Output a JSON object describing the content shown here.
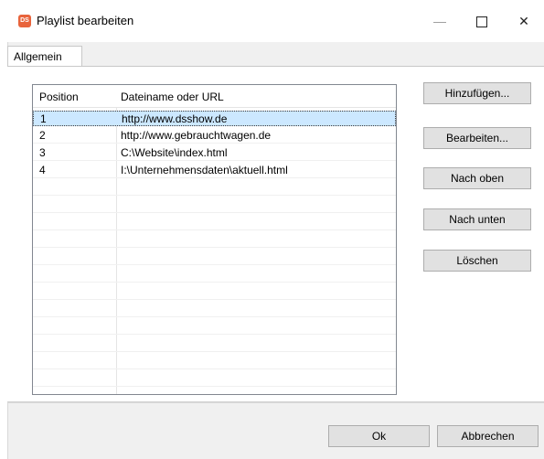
{
  "window": {
    "title": "Playlist bearbeiten",
    "app_icon_text": "DS",
    "minimize_glyph": "—",
    "close_glyph": "✕"
  },
  "tabs": [
    {
      "label": "Allgemein",
      "selected": true
    }
  ],
  "playlist": {
    "columns": [
      "Position",
      "Dateiname oder URL"
    ],
    "rows": [
      {
        "position": "1",
        "file": "http://www.dsshow.de",
        "selected": true
      },
      {
        "position": "2",
        "file": "http://www.gebrauchtwagen.de",
        "selected": false
      },
      {
        "position": "3",
        "file": "C:\\Website\\index.html",
        "selected": false
      },
      {
        "position": "4",
        "file": "I:\\Unternehmensdaten\\aktuell.html",
        "selected": false
      }
    ]
  },
  "side_buttons": {
    "add": "Hinzufügen...",
    "edit": "Bearbeiten...",
    "move_up": "Nach oben",
    "move_down": "Nach unten",
    "delete": "Löschen"
  },
  "footer_buttons": {
    "ok": "Ok",
    "cancel": "Abbrechen"
  }
}
